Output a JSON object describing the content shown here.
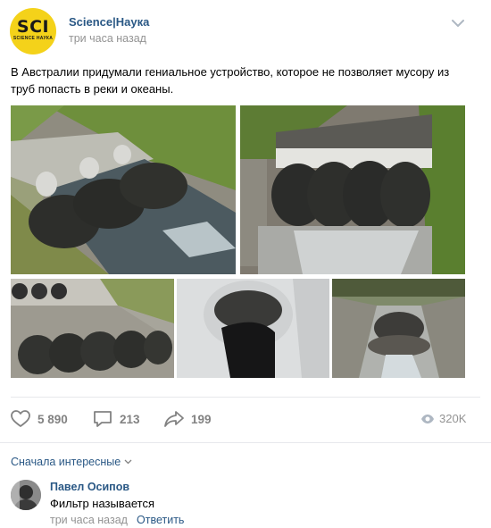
{
  "post": {
    "group_name": "Science|Наука",
    "time": "три часа назад",
    "avatar_text": "SCI",
    "avatar_subtext": "SCIENCE НАУКА",
    "text": "В Австралии придумали гениальное устройство, которое не позволяет мусору из труб попасть в реки и океаны.",
    "photos": [
      {
        "subject": "drain outlets with mesh nets on grassy bank"
      },
      {
        "subject": "concrete drain with row of mesh filter nets"
      },
      {
        "subject": "outflow pipes with nets in channel"
      },
      {
        "subject": "single pipe with black mesh net"
      },
      {
        "subject": "concrete channel with net bag"
      }
    ]
  },
  "actions": {
    "likes": "5 890",
    "comments": "213",
    "shares": "199",
    "views": "320K"
  },
  "comments": {
    "sort_label": "Сначала интересные",
    "items": [
      {
        "author": "Павел Осипов",
        "text": "Фильтр называется",
        "time": "три часа назад",
        "reply_label": "Ответить"
      }
    ]
  },
  "colors": {
    "link": "#2a5885",
    "muted": "#939393",
    "icon": "#828282",
    "avatar_bg": "#f4d21a"
  }
}
